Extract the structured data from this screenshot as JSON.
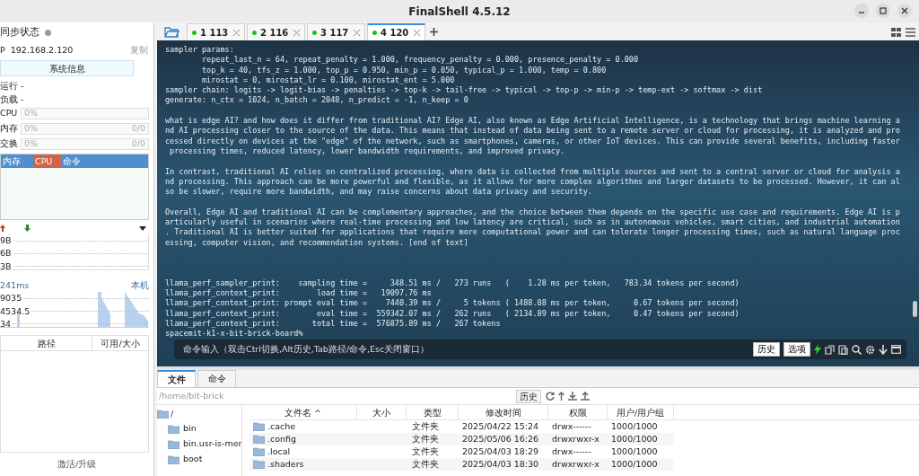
{
  "window": {
    "title": "FinalShell 4.5.12"
  },
  "sidebar": {
    "sync_label": "同步状态",
    "ip": "P  192.168.2.120",
    "copy": "复制",
    "info_button": "系统信息",
    "uptime": "运行 -",
    "load": "负载 -",
    "meters": [
      {
        "label": "CPU",
        "value": "0%"
      },
      {
        "label": "内存",
        "value": "0%",
        "extra": "0/0"
      },
      {
        "label": "交换",
        "value": "0%",
        "extra": "0/0"
      }
    ],
    "process_columns": [
      {
        "label": "内存",
        "color": "#4f8fd0"
      },
      {
        "label": "CPU",
        "color": "#d0644a"
      },
      {
        "label": "命令",
        "color": "#4f8fd0"
      }
    ],
    "net_ticks": [
      "9B",
      "6B",
      "3B"
    ],
    "latency": "241ms",
    "latency_host": "本机",
    "latency_ticks": [
      "9035",
      "4534.5",
      "34"
    ],
    "disk_columns": [
      "路径",
      "可用/大小"
    ],
    "footer": "激活/升级"
  },
  "tabs": [
    {
      "label": "1 113",
      "selected": false
    },
    {
      "label": "2 116",
      "selected": false
    },
    {
      "label": "3 117",
      "selected": false
    },
    {
      "label": "4 120",
      "selected": true
    }
  ],
  "terminal": {
    "blocks": [
      {
        "spaced": false,
        "lines": [
          "sampler params:",
          "        repeat_last_n = 64, repeat_penalty = 1.000, frequency_penalty = 0.000, presence_penalty = 0.000",
          "        top_k = 40, tfs_z = 1.000, top_p = 0.950, min_p = 0.050, typical_p = 1.000, temp = 0.800",
          "        mirostat = 0, mirostat_lr = 0.100, mirostat_ent = 5.000",
          "sampler chain: logits -> logit-bias -> penalties -> top-k -> tail-free -> typical -> top-p -> min-p -> temp-ext -> softmax -> dist",
          "generate: n_ctx = 1024, n_batch = 2048, n_predict = -1, n_keep = 0"
        ]
      },
      {
        "spaced": false,
        "lines": [
          "what is edge AI? and how does it differ from traditional AI? Edge AI, also known as Edge Artificial Intelligence, is a technology that brings machine learning a",
          "nd AI processing closer to the source of the data. This means that instead of data being sent to a remote server or cloud for processing, it is analyzed and pro",
          "cessed directly on devices at the \"edge\" of the network, such as smartphones, cameras, or other IoT devices. This can provide several benefits, including faster",
          " processing times, reduced latency, lower bandwidth requirements, and improved privacy."
        ]
      },
      {
        "spaced": false,
        "lines": [
          "In contrast, traditional AI relies on centralized processing, where data is collected from multiple sources and sent to a central server or cloud for analysis a",
          "nd processing. This approach can be more powerful and flexible, as it allows for more complex algorithms and larger datasets to be processed. However, it can al",
          "so be slower, require more bandwidth, and may raise concerns about data privacy and security."
        ]
      },
      {
        "spaced": false,
        "lines": [
          "Overall, Edge AI and traditional AI can be complementary approaches, and the choice between them depends on the specific use case and requirements. Edge AI is p",
          "articularly useful in scenarios where real-time processing and low latency are critical, such as in autonomous vehicles, smart cities, and industrial automation",
          ". Traditional AI is better suited for applications that require more computational power and can tolerate longer processing times, such as natural language proc",
          "essing, computer vision, and recommendation systems. [end of text]"
        ]
      },
      {
        "spaced": true,
        "lines": [
          "llama_perf_sampler_print:    sampling time =     348.51 ms /   273 runs   (    1.28 ms per token,   783.34 tokens per second)",
          "llama_perf_context_print:        load time =   19097.76 ms",
          "llama_perf_context_print: prompt eval time =    7440.39 ms /     5 tokens ( 1488.08 ms per token,     0.67 tokens per second)",
          "llama_perf_context_print:        eval time =  559342.07 ms /   262 runs   ( 2134.89 ms per token,     0.47 tokens per second)",
          "llama_perf_context_print:       total time =  576875.89 ms /   267 tokens",
          "spacemit-k1-x-bit-brick-board%"
        ]
      }
    ],
    "command_placeholder": "命令输入（双击Ctrl切换,Alt历史,Tab路径/命令,Esc关闭窗口）",
    "buttons": [
      "历史",
      "选项"
    ]
  },
  "files": {
    "tabs": [
      {
        "label": "文件",
        "selected": true
      },
      {
        "label": "命令",
        "selected": false
      }
    ],
    "path": "/home/bit-brick",
    "history_button": "历史",
    "tree": [
      {
        "label": "/",
        "children": [
          {
            "label": "bin"
          },
          {
            "label": "bin.usr-is-mer"
          },
          {
            "label": "boot"
          }
        ]
      }
    ],
    "columns": [
      "文件名 ^",
      "大小",
      "类型",
      "修改时间",
      "权限",
      "用户/用户组"
    ],
    "rows": [
      [
        ".cache",
        "",
        "文件夹",
        "2025/04/22 15:24",
        "drwx------",
        "1000/1000"
      ],
      [
        ".config",
        "",
        "文件夹",
        "2025/05/06 16:26",
        "drwxrwxr-x",
        "1000/1000"
      ],
      [
        ".local",
        "",
        "文件夹",
        "2025/04/03 18:29",
        "drwx------",
        "1000/1000"
      ],
      [
        ".shaders",
        "",
        "文件夹",
        "2025/04/03 18:30",
        "drwxrwxr-x",
        "1000/1000"
      ]
    ]
  }
}
